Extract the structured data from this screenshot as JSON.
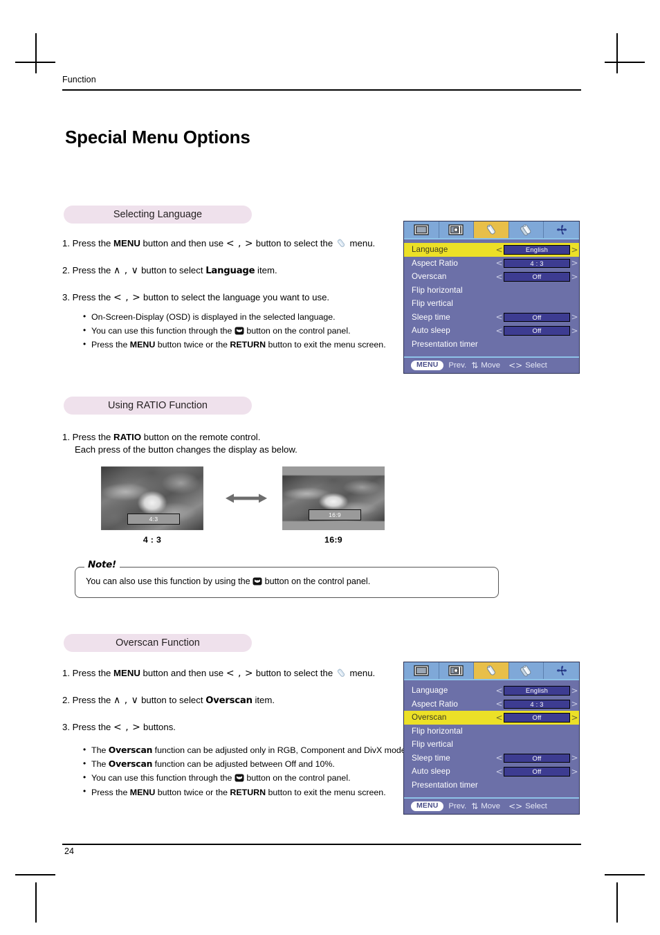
{
  "page": {
    "running_head": "Function",
    "title": "Special Menu Options",
    "number": "24"
  },
  "sections": {
    "language": {
      "heading": "Selecting Language",
      "steps": [
        {
          "n": "1.",
          "pre": "Press the ",
          "b1": "MENU",
          "mid": " button and then use ",
          "sym": "< , >",
          "post": " button to select the ",
          "icon": "special-menu-icon",
          "tail": " menu."
        },
        {
          "n": "2.",
          "pre": "Press the ",
          "sym": "∧ , ∨",
          "mid": " button to select ",
          "b1": "Language",
          "post": " item."
        },
        {
          "n": "3.",
          "pre": "Press the ",
          "sym": "< , >",
          "post": " button to select the language you want to use."
        }
      ],
      "bullets": [
        {
          "text": "On-Screen-Display (OSD) is displayed in the selected language."
        },
        {
          "pre": "You can use this function through the ",
          "icon": "control-panel-icon",
          "post": " button on the control panel."
        },
        {
          "pre": "Press the ",
          "b1": "MENU",
          "mid": " button twice or the ",
          "b2": "RETURN",
          "post": " button to exit the menu screen."
        }
      ]
    },
    "ratio": {
      "heading": "Using RATIO Function",
      "steps": [
        {
          "n": "1.",
          "line1_pre": "Press the ",
          "b1": "RATIO",
          "line1_post": " button on the remote control.",
          "line2": "Each press of the button changes the display as below."
        }
      ],
      "thumbnails": [
        {
          "badge": "4:3",
          "caption": "4 : 3",
          "mode": "fullscreen"
        },
        {
          "badge": "16:9",
          "caption": "16:9",
          "mode": "letterbox"
        }
      ],
      "arrow_icon": "double-arrow-icon"
    },
    "note": {
      "label": "Note!",
      "pre": "You can also use this function by using the ",
      "icon": "control-panel-icon",
      "post": " button on the control panel."
    },
    "overscan": {
      "heading": "Overscan Function",
      "steps": [
        {
          "n": "1.",
          "pre": "Press the ",
          "b1": "MENU",
          "mid": " button and then use ",
          "sym": "< , >",
          "post": " button to select the ",
          "icon": "special-menu-icon",
          "tail": " menu."
        },
        {
          "n": "2.",
          "pre": "Press the ",
          "sym": "∧ , ∨",
          "mid": " button to select ",
          "b1": "Overscan",
          "post": " item."
        },
        {
          "n": "3.",
          "pre": "Press the ",
          "sym": "< , >",
          "post": " buttons."
        }
      ],
      "bullets": [
        {
          "pre": "The ",
          "b1": "Overscan",
          "post": " function can be adjusted only in RGB, Component and DivX modes."
        },
        {
          "pre": "The ",
          "b1": "Overscan",
          "post": " function can be adjusted between Off and 10%."
        },
        {
          "pre": "You can use this function through the ",
          "icon": "control-panel-icon",
          "post": " button on the control panel."
        },
        {
          "pre": "Press the ",
          "b1": "MENU",
          "mid": " button twice or the ",
          "b2": "RETURN",
          "post": " button to exit the menu screen."
        }
      ]
    }
  },
  "osd": {
    "tabs": [
      {
        "name": "picture-tab",
        "icon": "screen-icon",
        "active": false
      },
      {
        "name": "screen-tab",
        "icon": "pip-screen-icon",
        "active": false
      },
      {
        "name": "special-tab",
        "icon": "single-page-icon",
        "active": true
      },
      {
        "name": "option-tab",
        "icon": "multi-page-icon",
        "active": false
      },
      {
        "name": "usb-tab",
        "icon": "pinwheel-icon",
        "active": false
      }
    ],
    "rows": [
      {
        "label": "Language",
        "value": "English",
        "has_value": true
      },
      {
        "label": "Aspect Ratio",
        "value": "4 : 3",
        "has_value": true
      },
      {
        "label": "Overscan",
        "value": "Off",
        "has_value": true
      },
      {
        "label": "Flip horizontal",
        "has_value": false
      },
      {
        "label": "Flip vertical",
        "has_value": false
      },
      {
        "label": "Sleep time",
        "value": "Off",
        "has_value": true
      },
      {
        "label": "Auto sleep",
        "value": "Off",
        "has_value": true
      },
      {
        "label": "Presentation timer",
        "has_value": false
      }
    ],
    "left_arrow": "<",
    "right_arrow": ">",
    "footer": {
      "menu_label": "MENU",
      "prev_label": "Prev.",
      "move_symbol": "⇅",
      "move_label": "Move",
      "select_symbol": "<>",
      "select_label": "Select"
    },
    "panel_top": {
      "selected_index": 0
    },
    "panel_bottom": {
      "selected_index": 2
    }
  },
  "colors": {
    "osd_background": "#6c70a8",
    "osd_highlight": "#ece027",
    "osd_value_box": "#3d3c91",
    "osd_tab_bar": "#7fa8d8",
    "osd_tab_active": "#e8bf49",
    "section_pill": "#efe1ec"
  }
}
